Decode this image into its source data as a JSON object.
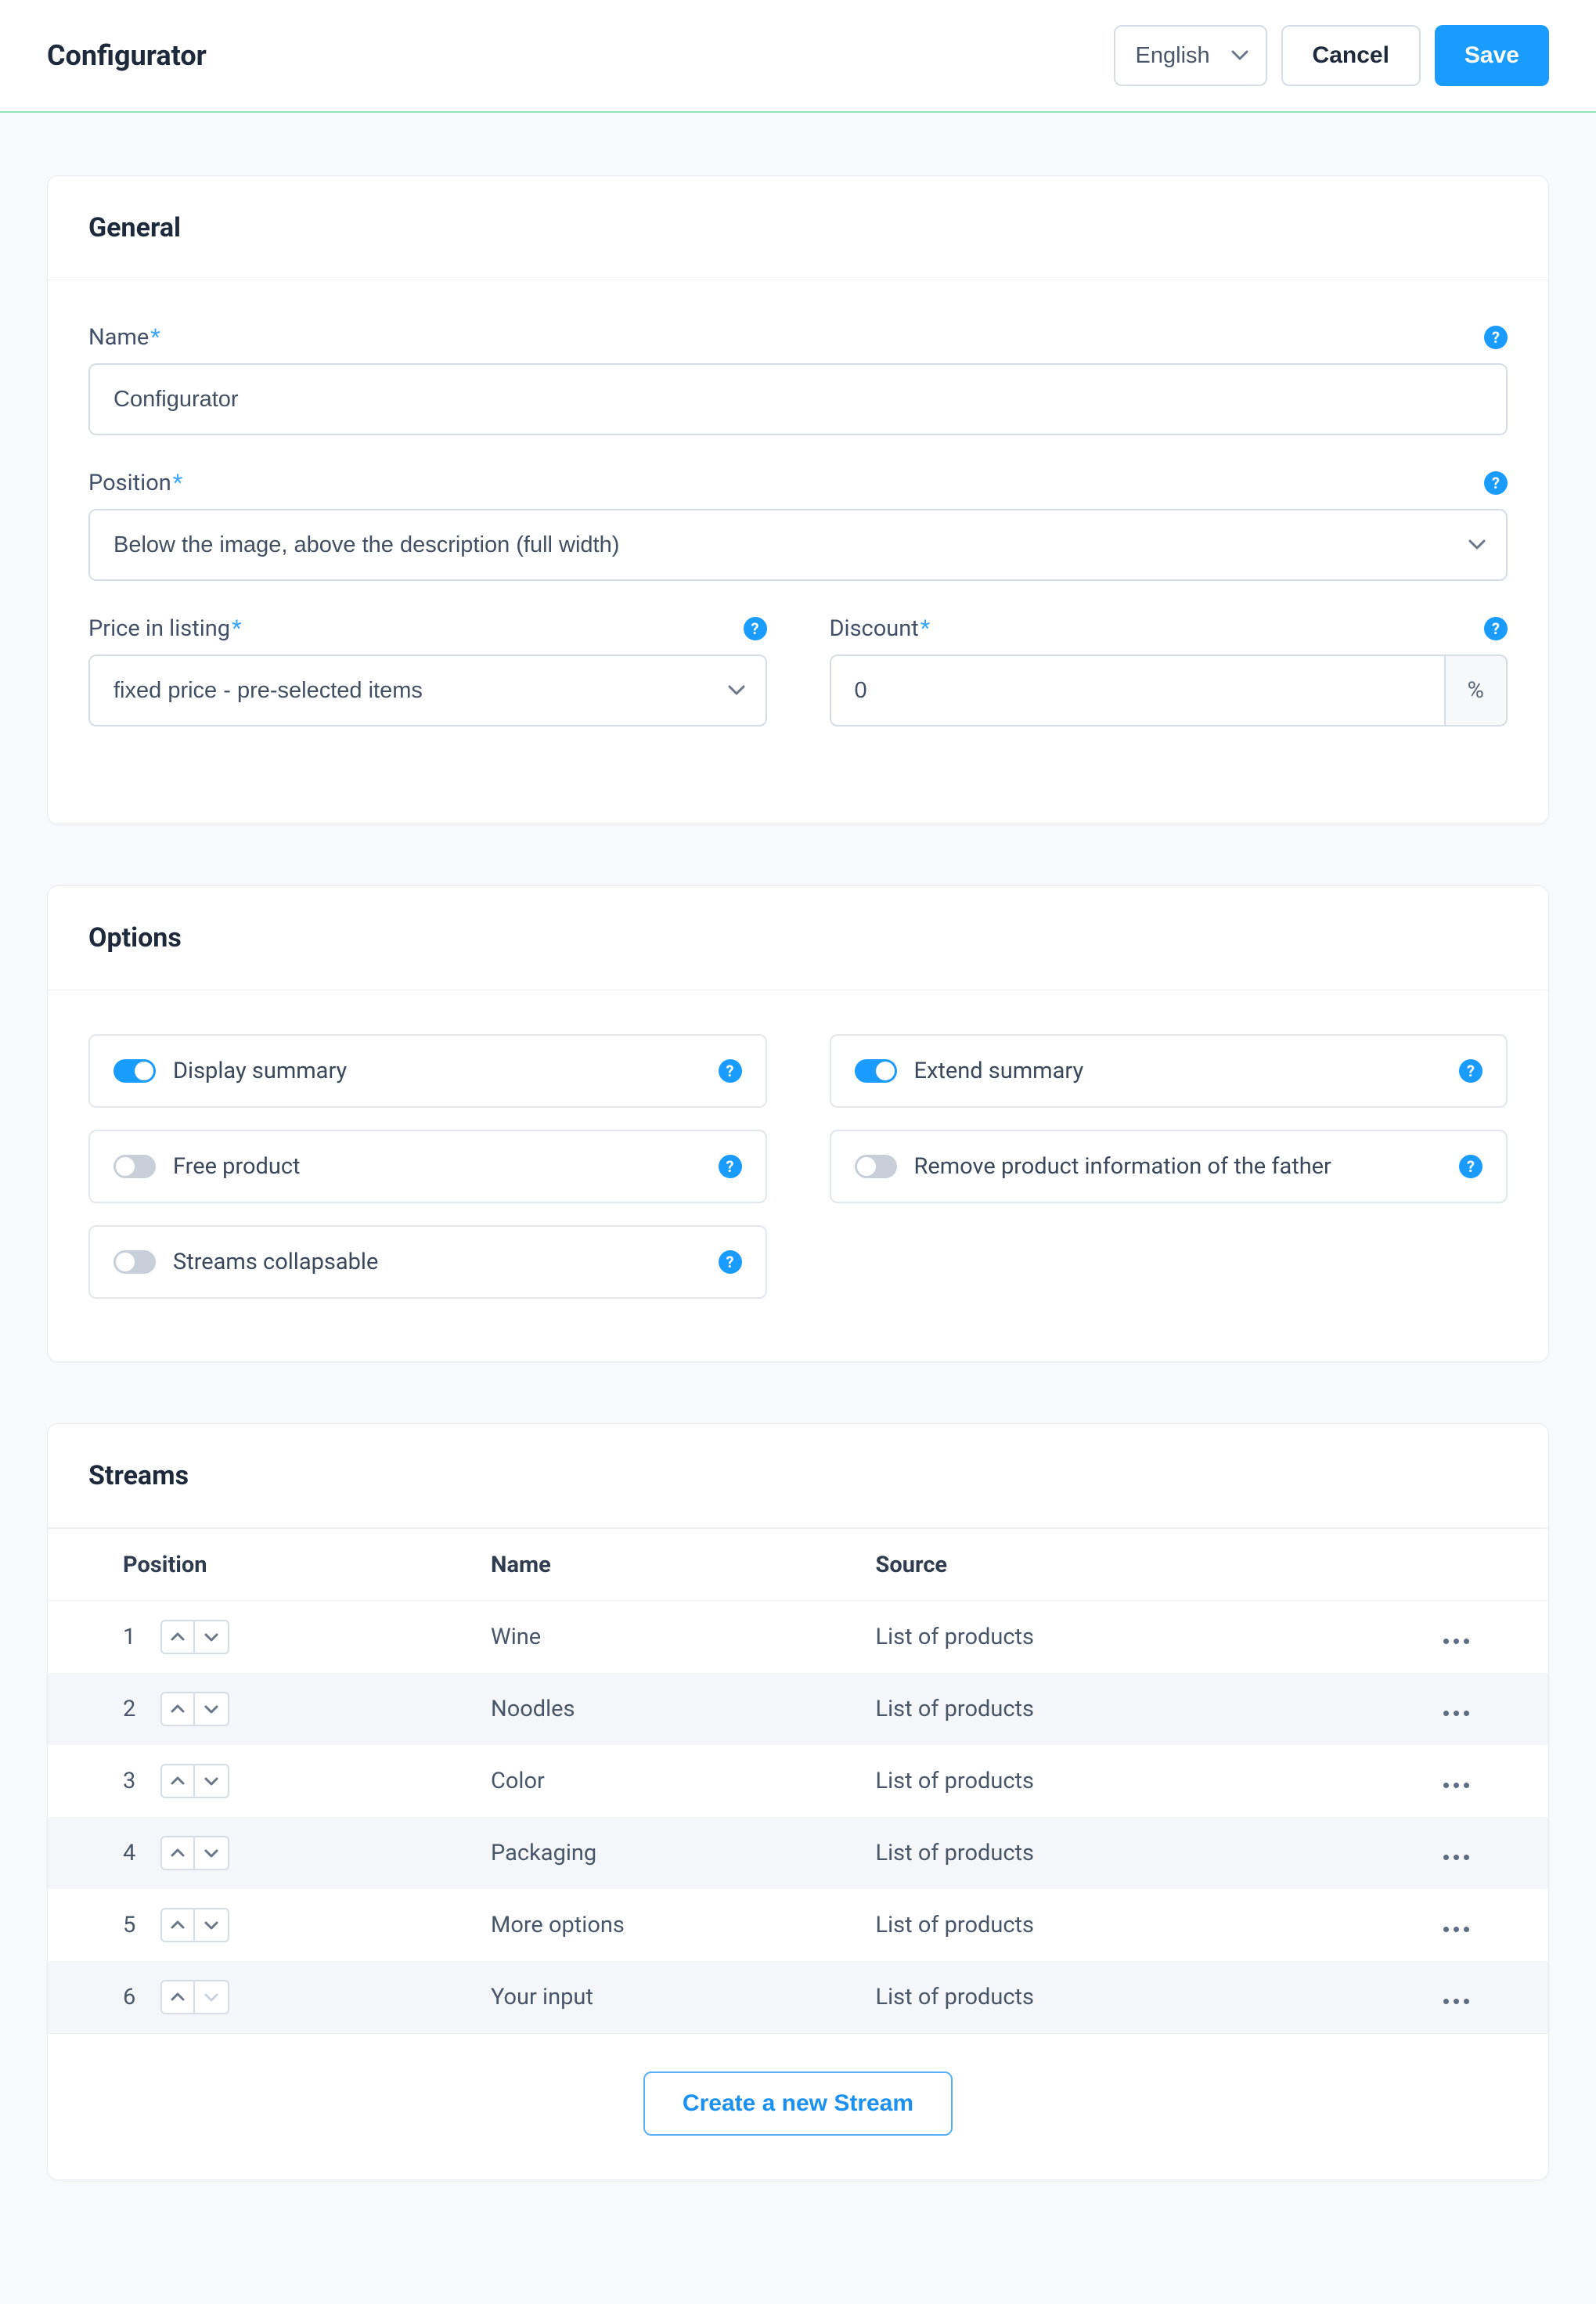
{
  "header": {
    "title": "Configurator",
    "language": "English",
    "cancel": "Cancel",
    "save": "Save"
  },
  "general": {
    "title": "General",
    "name_label": "Name",
    "name_value": "Configurator",
    "position_label": "Position",
    "position_value": "Below the image, above the description (full width)",
    "price_label": "Price in listing",
    "price_value": "fixed price - pre-selected items",
    "discount_label": "Discount",
    "discount_value": "0",
    "discount_unit": "%"
  },
  "options": {
    "title": "Options",
    "items": [
      {
        "label": "Display summary",
        "on": true
      },
      {
        "label": "Extend summary",
        "on": true
      },
      {
        "label": "Free product",
        "on": false
      },
      {
        "label": "Remove product information of the father",
        "on": false
      },
      {
        "label": "Streams collapsable",
        "on": false
      }
    ]
  },
  "streams": {
    "title": "Streams",
    "columns": {
      "position": "Position",
      "name": "Name",
      "source": "Source"
    },
    "rows": [
      {
        "pos": "1",
        "name": "Wine",
        "source": "List of products"
      },
      {
        "pos": "2",
        "name": "Noodles",
        "source": "List of products"
      },
      {
        "pos": "3",
        "name": "Color",
        "source": "List of products"
      },
      {
        "pos": "4",
        "name": "Packaging",
        "source": "List of products"
      },
      {
        "pos": "5",
        "name": "More options",
        "source": "List of products"
      },
      {
        "pos": "6",
        "name": "Your input",
        "source": "List of products"
      }
    ],
    "create": "Create a new Stream"
  }
}
